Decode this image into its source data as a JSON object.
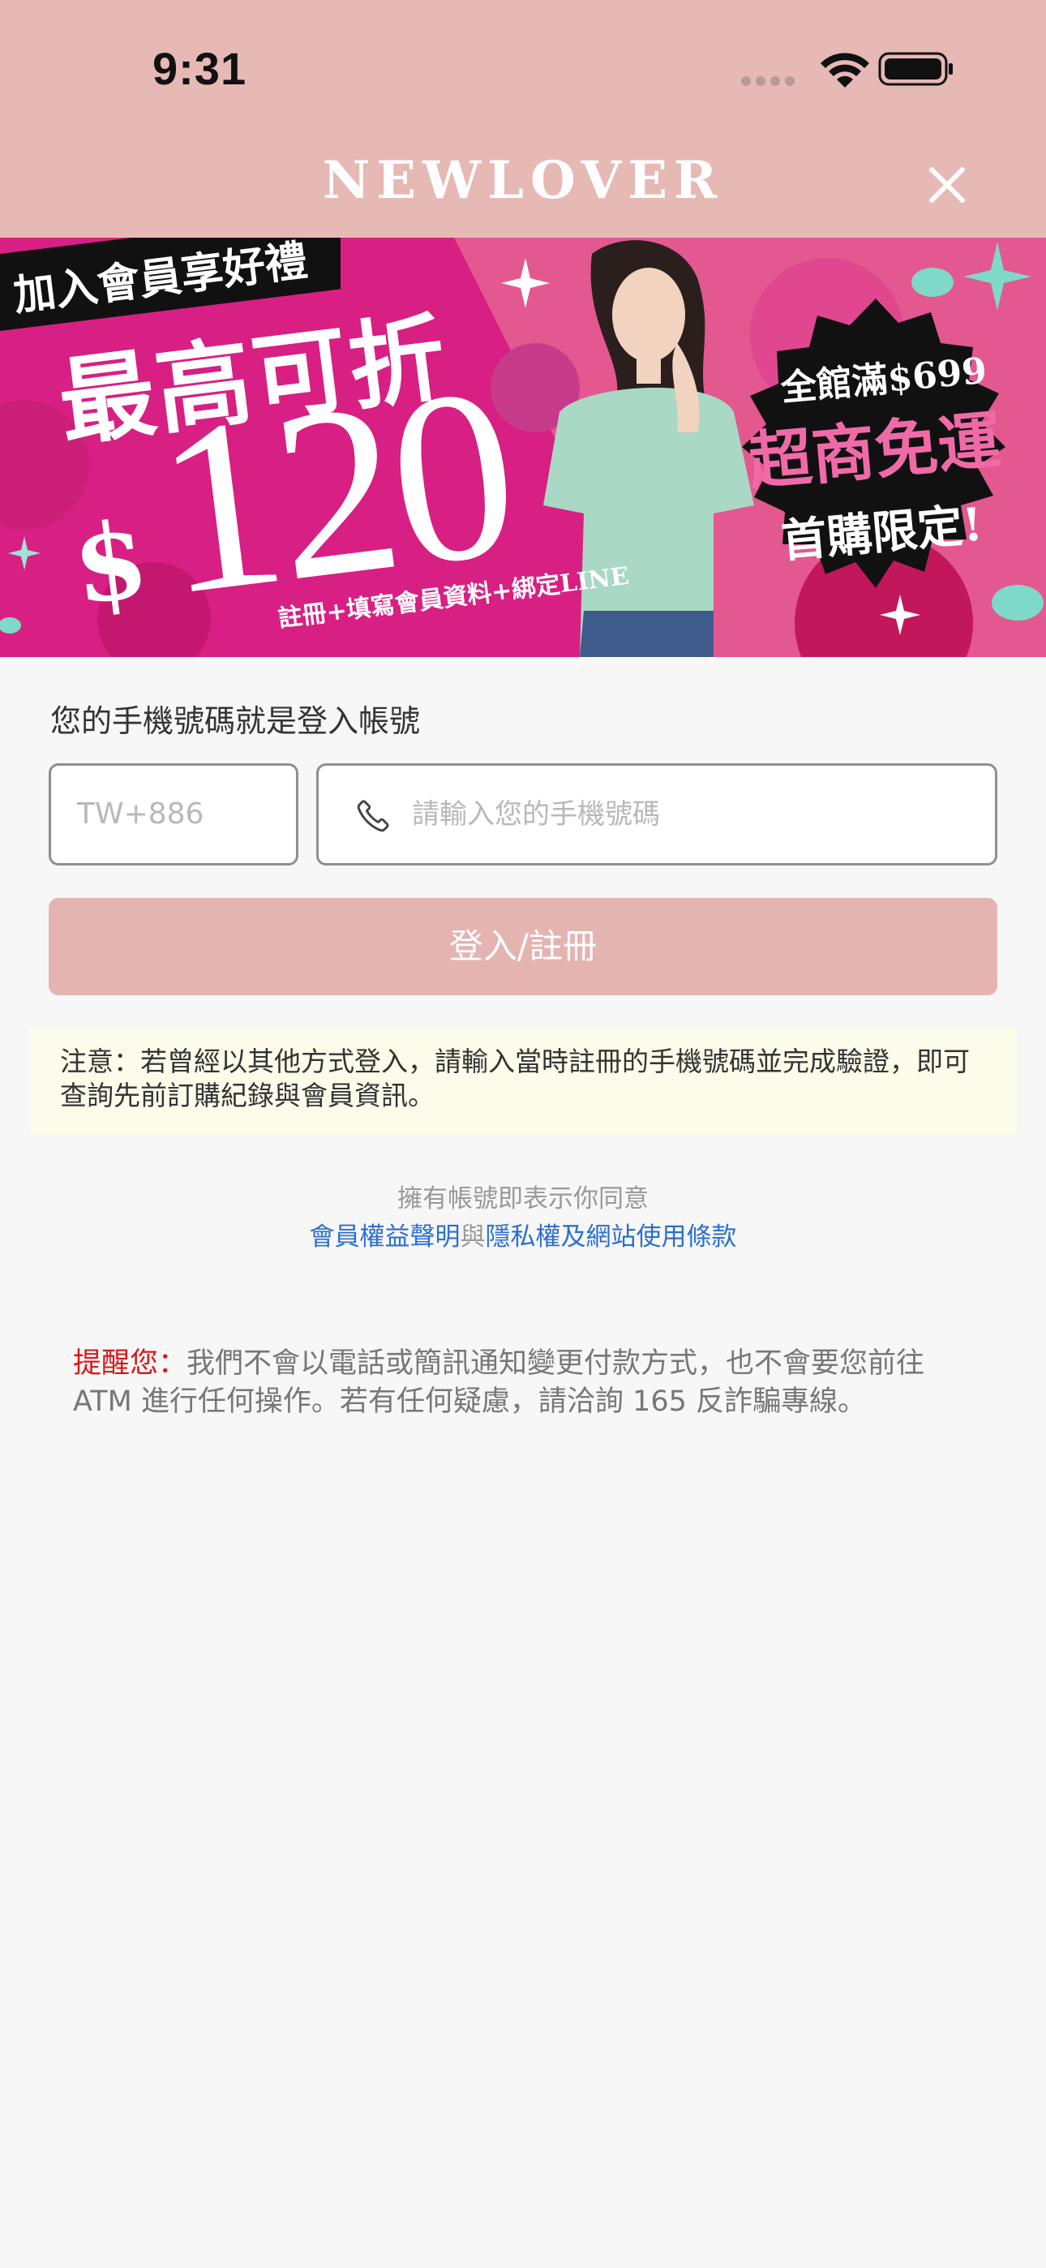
{
  "status_bar": {
    "time": "9:31"
  },
  "header": {
    "title": "NEWLOVER",
    "close_icon": "close-icon"
  },
  "banner": {
    "tag": "加入會員享好禮",
    "headline": "最高可折",
    "currency": "$",
    "amount": "120",
    "fineprint": "註冊+填寫會員資料+綁定LINE",
    "badge_line1": "全館滿$699",
    "badge_line2": "超商免運",
    "badge_line3": "首購限定!",
    "colors": {
      "background": "#d81f83",
      "badge": "#111111",
      "accent": "#7ed9c9"
    }
  },
  "form": {
    "label": "您的手機號碼就是登入帳號",
    "country_code_placeholder": "TW+886",
    "phone_placeholder": "請輸入您的手機號碼",
    "phone_icon": "phone-icon",
    "submit_label": "登入/註冊"
  },
  "notice": {
    "text": "注意：若曾經以其他方式登入，請輸入當時註冊的手機號碼並完成驗證，即可查詢先前訂購紀錄與會員資訊。"
  },
  "agreement": {
    "intro": "擁有帳號即表示你同意",
    "link1": "會員權益聲明",
    "connector": "與",
    "link2": "隱私權及網站使用條款"
  },
  "reminder": {
    "lead": "提醒您：",
    "body": "我們不會以電話或簡訊通知變更付款方式，也不會要您前往 ATM 進行任何操作。若有任何疑慮，請洽詢 165 反詐騙專線。"
  },
  "colors": {
    "header_bg": "#e6b9b5",
    "button_bg": "#e4b4b0",
    "notice_bg": "#fdfbea",
    "link": "#2b6fce",
    "warning": "#d81818"
  }
}
